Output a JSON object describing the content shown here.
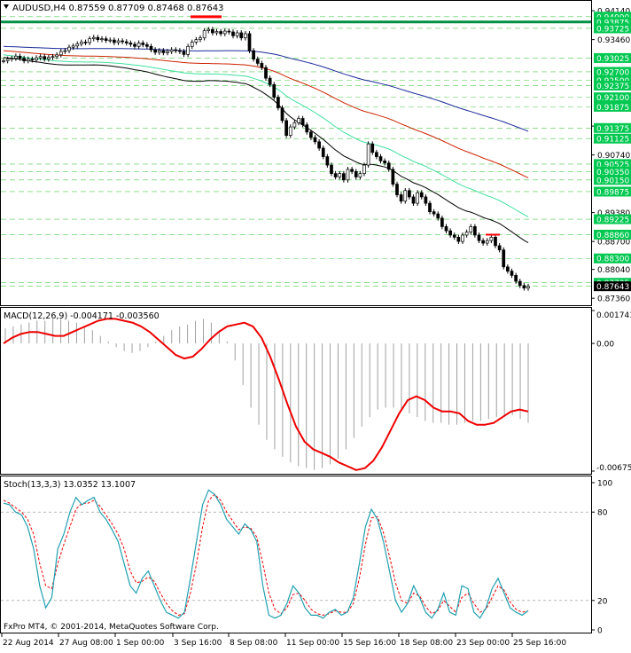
{
  "header": {
    "symbol_line": "AUDUSD,H4  0.87559 0.87709 0.87468 0.87643"
  },
  "footer": {
    "copyright": "FxPro MT4, © 2001-2014, MetaQuotes Software Corp."
  },
  "colors": {
    "background": "#ffffff",
    "frame": "#000000",
    "grid_dashed": "#00b400",
    "price_line": "#000000",
    "ma_black": "#000000",
    "ma_teal": "#40e0a0",
    "ma_red": "#cc2200",
    "ma_blue": "#1a2a9a",
    "resistance_green": "#009040",
    "marker_red": "#ff0000",
    "label_green_bg": "#00c850",
    "macd_hist": "#a0a0a0",
    "macd_signal": "#ee0000",
    "stoch_main": "#20a0b0",
    "stoch_signal": "#ee0000"
  },
  "chart_data": [
    {
      "type": "candlestick",
      "title": "AUDUSD,H4",
      "ohlc_last": {
        "open": 0.87559,
        "high": 0.87709,
        "low": 0.87468,
        "close": 0.87643
      },
      "ylim": [
        0.8728,
        0.9431
      ],
      "y_ticks_plain": [
        "0.94140",
        "0.93460",
        "0.91420",
        "0.90740",
        "0.89380",
        "0.88700",
        "0.88040",
        "0.87360"
      ],
      "y_labels_highlight": [
        "0.94000",
        "0.93875",
        "0.93725",
        "0.93025",
        "0.92700",
        "0.92500",
        "0.92375",
        "0.92100",
        "0.91875",
        "0.91375",
        "0.91125",
        "0.90525",
        "0.90350",
        "0.90150",
        "0.89875",
        "0.89225",
        "0.88860",
        "0.88300",
        "0.87725",
        "0.87643"
      ],
      "x_labels": [
        "22 Aug 2014",
        "27 Aug 08:00",
        "1 Sep 00:00",
        "3 Sep 16:00",
        "8 Sep 08:00",
        "11 Sep 00:00",
        "15 Sep 16:00",
        "18 Sep 08:00",
        "23 Sep 00:00",
        "25 Sep 16:00"
      ],
      "close_series": [
        0.9296,
        0.93,
        0.9302,
        0.9307,
        0.9302,
        0.9296,
        0.93,
        0.9298,
        0.9303,
        0.9306,
        0.93,
        0.9304,
        0.9306,
        0.931,
        0.9318,
        0.932,
        0.9328,
        0.9331,
        0.9336,
        0.934,
        0.9339,
        0.9348,
        0.9351,
        0.9346,
        0.9348,
        0.9344,
        0.9345,
        0.9339,
        0.9343,
        0.9341,
        0.9338,
        0.9335,
        0.933,
        0.9338,
        0.9334,
        0.933,
        0.9322,
        0.9316,
        0.932,
        0.9315,
        0.9318,
        0.9322,
        0.932,
        0.9318,
        0.9311,
        0.933,
        0.934,
        0.9346,
        0.935,
        0.9367,
        0.937,
        0.9362,
        0.9365,
        0.936,
        0.9366,
        0.9364,
        0.9355,
        0.9362,
        0.935,
        0.936,
        0.932,
        0.93,
        0.929,
        0.928,
        0.9255,
        0.924,
        0.921,
        0.9185,
        0.9155,
        0.912,
        0.914,
        0.915,
        0.916,
        0.9145,
        0.9128,
        0.9115,
        0.9105,
        0.909,
        0.907,
        0.905,
        0.903,
        0.9022,
        0.903,
        0.9015,
        0.904,
        0.9035,
        0.9022,
        0.903,
        0.905,
        0.91,
        0.908,
        0.907,
        0.906,
        0.9055,
        0.904,
        0.9005,
        0.898,
        0.8965,
        0.899,
        0.8975,
        0.896,
        0.8985,
        0.8975,
        0.896,
        0.894,
        0.8935,
        0.8925,
        0.8905,
        0.8895,
        0.8885,
        0.888,
        0.887,
        0.8885,
        0.8892,
        0.8905,
        0.8885,
        0.8872,
        0.8866,
        0.8872,
        0.888,
        0.886,
        0.885,
        0.881,
        0.88,
        0.879,
        0.8776,
        0.8766,
        0.876,
        0.8764
      ],
      "moving_averages": [
        {
          "color_key": "ma_black",
          "y_start": 0.9304,
          "y_end": 0.8867
        },
        {
          "color_key": "ma_teal",
          "y_start": 0.931,
          "y_end": 0.8928
        },
        {
          "color_key": "ma_red",
          "y_start": 0.932,
          "y_end": 0.902
        },
        {
          "color_key": "ma_blue",
          "y_start": 0.933,
          "y_end": 0.913
        }
      ],
      "resistance_level": 0.93875,
      "marker_levels": [
        0.94,
        0.8886
      ]
    },
    {
      "type": "macd",
      "title": "MACD(12,26,9) -0.004171 -0.003560",
      "params": [
        12,
        26,
        9
      ],
      "macd_value": -0.004171,
      "signal_value": -0.00356,
      "ylim": [
        -0.006756,
        0.001741
      ],
      "y_labels": [
        "0.001741",
        "0.00",
        "-0.006756"
      ],
      "histogram": [
        0.0008,
        0.0009,
        0.001,
        0.0011,
        0.0012,
        0.0012,
        0.0013,
        0.0013,
        0.0012,
        0.0011,
        0.0009,
        0.0007,
        0.0004,
        0.0001,
        -0.0002,
        -0.0004,
        -0.0005,
        -0.0004,
        -0.0002,
        0.0001,
        0.0004,
        0.0007,
        0.0009,
        0.001,
        0.0012,
        0.0013,
        0.0011,
        0.0007,
        0.0001,
        -0.0009,
        -0.0022,
        -0.0034,
        -0.0043,
        -0.0051,
        -0.0056,
        -0.006,
        -0.0063,
        -0.0065,
        -0.0066,
        -0.0067,
        -0.0066,
        -0.0064,
        -0.0061,
        -0.0056,
        -0.005,
        -0.0044,
        -0.0039,
        -0.0035,
        -0.0034,
        -0.0034,
        -0.0035,
        -0.0037,
        -0.0039,
        -0.0041,
        -0.0042,
        -0.0042,
        -0.0043,
        -0.0043,
        -0.0042,
        -0.0041,
        -0.0041,
        -0.004,
        -0.0039,
        -0.0038,
        -0.0038,
        -0.004,
        -0.0042
      ],
      "signal_line": [
        0.0,
        0.0003,
        0.0005,
        0.0006,
        0.0006,
        0.0005,
        0.0004,
        0.0004,
        0.0006,
        0.0008,
        0.001,
        0.0012,
        0.0013,
        0.0013,
        0.0012,
        0.0011,
        0.0009,
        0.0006,
        0.0002,
        -0.0002,
        -0.0006,
        -0.0008,
        -0.0007,
        -0.0003,
        0.0002,
        0.0006,
        0.0009,
        0.001,
        0.0011,
        0.0009,
        0.0003,
        -0.0007,
        -0.0019,
        -0.0032,
        -0.0044,
        -0.0052,
        -0.0056,
        -0.0058,
        -0.006,
        -0.0063,
        -0.0065,
        -0.0067,
        -0.0066,
        -0.0062,
        -0.0055,
        -0.0046,
        -0.0037,
        -0.003,
        -0.0028,
        -0.003,
        -0.0034,
        -0.0036,
        -0.0036,
        -0.0037,
        -0.0041,
        -0.0043,
        -0.0043,
        -0.0042,
        -0.0039,
        -0.0036,
        -0.0035,
        -0.0036
      ]
    },
    {
      "type": "stochastic",
      "title": "Stoch(13,3,3) 13.0352 13.1007",
      "params": [
        13,
        3,
        3
      ],
      "main_value": 13.0352,
      "signal_value": 13.1007,
      "ylim": [
        0,
        100
      ],
      "levels": [
        80,
        20
      ],
      "y_labels": [
        "100",
        "80",
        "20",
        "0"
      ],
      "main": [
        86,
        85,
        80,
        78,
        70,
        55,
        30,
        15,
        22,
        55,
        65,
        80,
        90,
        85,
        88,
        90,
        80,
        75,
        68,
        60,
        45,
        30,
        25,
        35,
        40,
        30,
        20,
        12,
        10,
        8,
        12,
        35,
        60,
        85,
        95,
        92,
        85,
        75,
        70,
        65,
        72,
        68,
        60,
        30,
        10,
        8,
        10,
        18,
        30,
        25,
        15,
        10,
        10,
        8,
        12,
        14,
        10,
        12,
        22,
        45,
        70,
        82,
        75,
        60,
        40,
        20,
        12,
        18,
        30,
        22,
        12,
        8,
        14,
        25,
        12,
        10,
        30,
        28,
        12,
        8,
        15,
        28,
        35,
        25,
        15,
        12,
        10,
        13
      ],
      "signal": [
        88,
        86,
        83,
        80,
        75,
        65,
        45,
        30,
        28,
        45,
        58,
        70,
        82,
        86,
        86,
        88,
        84,
        78,
        72,
        65,
        55,
        40,
        32,
        33,
        36,
        33,
        25,
        18,
        13,
        10,
        11,
        25,
        45,
        70,
        88,
        92,
        88,
        80,
        74,
        68,
        70,
        69,
        63,
        45,
        25,
        14,
        11,
        15,
        24,
        25,
        20,
        14,
        11,
        10,
        11,
        13,
        12,
        12,
        18,
        35,
        58,
        76,
        77,
        66,
        50,
        32,
        20,
        18,
        25,
        23,
        16,
        11,
        13,
        20,
        16,
        12,
        22,
        25,
        18,
        12,
        14,
        22,
        30,
        27,
        19,
        14,
        12,
        13
      ]
    }
  ]
}
